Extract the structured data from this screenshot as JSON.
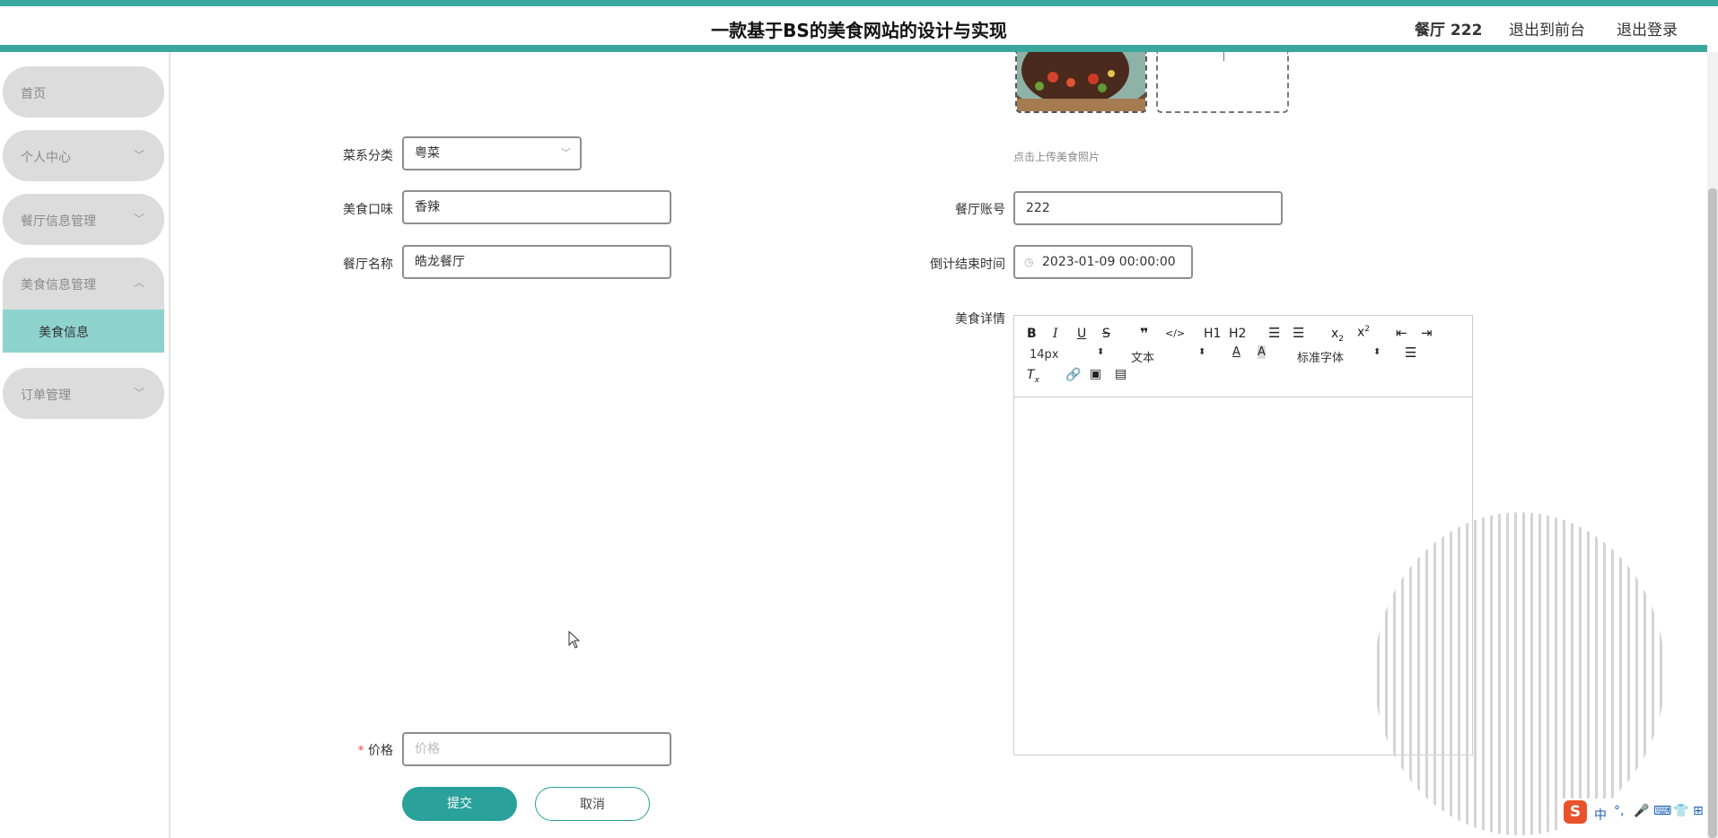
{
  "header": {
    "title": "一款基于BS的美食网站的设计与实现",
    "user": "餐厅 222",
    "to_front": "退出到前台",
    "logout": "退出登录"
  },
  "sidebar": {
    "items": [
      {
        "label": "首页"
      },
      {
        "label": "个人中心"
      },
      {
        "label": "餐厅信息管理"
      },
      {
        "label": "美食信息管理"
      },
      {
        "label": "订单管理"
      }
    ],
    "sub_item": "美食信息"
  },
  "form": {
    "cuisine_label": "菜系分类",
    "cuisine_value": "粤菜",
    "flavor_label": "美食口味",
    "flavor_value": "香辣",
    "restaurant_name_label": "餐厅名称",
    "restaurant_name_value": "皓龙餐厅",
    "account_label": "餐厅账号",
    "account_value": "222",
    "countdown_label": "倒计结束时间",
    "countdown_value": "2023-01-09 00:00:00",
    "detail_label": "美食详情",
    "upload_hint": "点击上传美食照片",
    "price_label": "价格",
    "price_placeholder": "价格",
    "required_mark": "*",
    "submit": "提交",
    "cancel": "取消"
  },
  "editor": {
    "font_size": "14px",
    "paragraph": "文本",
    "font_family": "标准字体",
    "h1": "H1",
    "h2": "H2"
  },
  "colors": {
    "accent": "#3ba8a0",
    "button": "#2aa19b",
    "sidebar_active": "#8fd3cf"
  }
}
